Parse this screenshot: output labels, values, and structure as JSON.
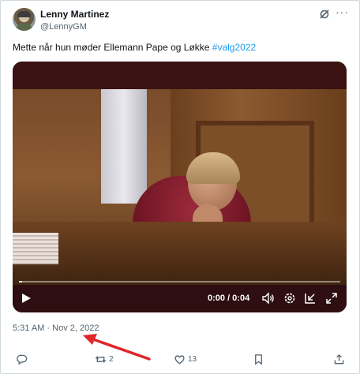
{
  "author": {
    "display_name": "Lenny Martinez",
    "handle": "@LennyGM"
  },
  "tweet": {
    "text": "Mette når hun møder Ellemann Pape og Løkke ",
    "hashtag": "#valg2022",
    "timestamp": "5:31 AM · Nov 2, 2022"
  },
  "video": {
    "time_display": "0:00 / 0:04",
    "progress_fraction": 0.01
  },
  "actions": {
    "reply_count": "",
    "retweet_count": "2",
    "like_count": "13"
  },
  "icons": {
    "header": [
      "grok-icon",
      "more-icon"
    ],
    "video_controls": [
      "play-icon",
      "volume-icon",
      "settings-icon",
      "dock-icon",
      "fullscreen-icon"
    ],
    "actions": [
      "reply-icon",
      "retweet-icon",
      "like-icon",
      "bookmark-icon",
      "share-icon"
    ]
  },
  "colors": {
    "hashtag": "#1d9bf0",
    "annotation_arrow": "#e0262b",
    "secondary_text": "#536471"
  }
}
